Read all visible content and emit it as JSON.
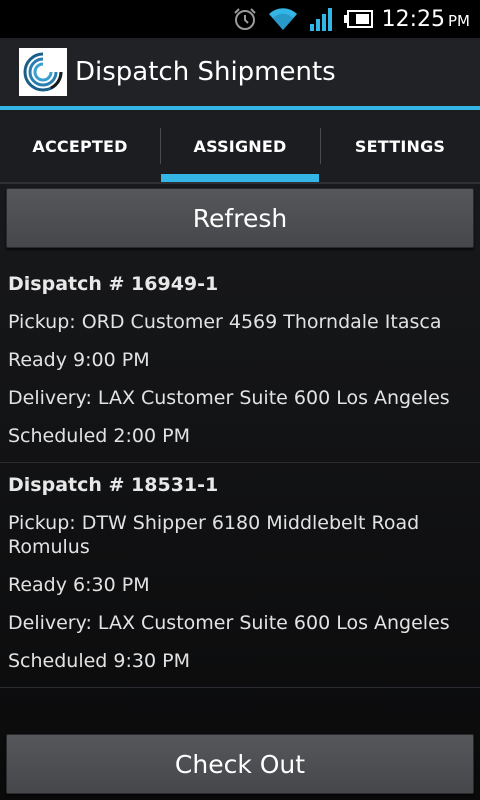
{
  "status_bar": {
    "time": "12:25",
    "ampm": "PM",
    "icons": [
      "alarm-icon",
      "wifi-icon",
      "signal-icon",
      "battery-icon"
    ]
  },
  "action_bar": {
    "title": "Dispatch Shipments",
    "logo": "app-logo-icon"
  },
  "tabs": [
    {
      "label": "ACCEPTED",
      "active": false
    },
    {
      "label": "ASSIGNED",
      "active": true
    },
    {
      "label": "SETTINGS",
      "active": false
    }
  ],
  "buttons": {
    "refresh": "Refresh",
    "checkout": "Check Out"
  },
  "dispatches": [
    {
      "title": "Dispatch # 16949-1",
      "pickup": "Pickup: ORD Customer 4569 Thorndale Itasca",
      "ready": "Ready 9:00 PM",
      "delivery": "Delivery: LAX Customer Suite 600 Los Angeles",
      "scheduled": "Scheduled 2:00 PM"
    },
    {
      "title": "Dispatch # 18531-1",
      "pickup": "Pickup: DTW Shipper 6180 Middlebelt Road Romulus",
      "ready": "Ready 6:30 PM",
      "delivery": "Delivery: LAX Customer Suite 600 Los Angeles",
      "scheduled": "Scheduled 9:30 PM"
    }
  ],
  "colors": {
    "accent": "#33b5e5",
    "actionbar": "#212225",
    "background": "#0b0c0e"
  }
}
